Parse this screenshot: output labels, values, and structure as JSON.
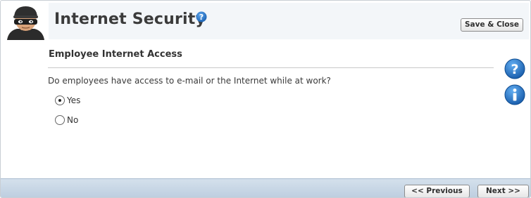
{
  "header": {
    "title": "Internet Security",
    "save_close_label": "Save & Close",
    "avatar_icon": "burglar-mask-avatar-icon",
    "help_icon": "question-mark-icon"
  },
  "section": {
    "title": "Employee Internet Access",
    "question": "Do employees have access to e-mail or the Internet while at work?",
    "options": [
      {
        "label": "Yes",
        "selected": true
      },
      {
        "label": "No",
        "selected": false
      }
    ]
  },
  "side_icons": {
    "help": "help-icon",
    "info": "info-icon"
  },
  "footer": {
    "previous_label": "<< Previous",
    "next_label": "Next >>"
  },
  "colors": {
    "header_band": "#f3f6f9",
    "footer_gradient_top": "#d4e0ec",
    "footer_gradient_bottom": "#bccddf",
    "icon_blue": "#1e6fc6"
  }
}
